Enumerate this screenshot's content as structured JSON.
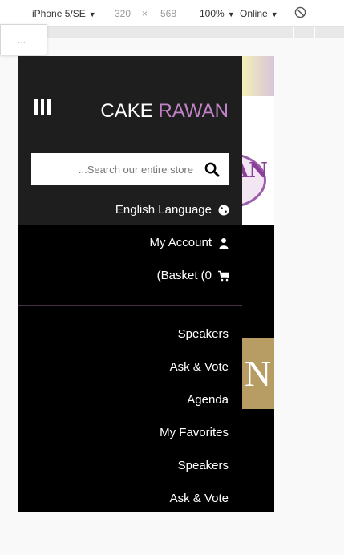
{
  "devtools": {
    "device": "iPhone 5/SE",
    "width": "320",
    "times": "×",
    "height": "568",
    "zoom": "100%",
    "throttle": "Online",
    "more_menu": "..."
  },
  "background": {
    "logo_text": "AN",
    "sign_text": "OPEN"
  },
  "drawer": {
    "brand_part1": "CAKE",
    "brand_part2": "RAWAN",
    "search_placeholder": "...Search our entire store",
    "language": "English Language",
    "account": "My Account",
    "basket": "(Basket (0",
    "menu": [
      "Speakers",
      "Ask & Vote",
      "Agenda",
      "My Favorites",
      "Speakers",
      "Ask & Vote"
    ]
  },
  "colors": {
    "drawer_bg": "#000000",
    "drawer_head_bg": "#1e1e1e",
    "brand_accent": "#c083c6",
    "divider": "#4a2f4c"
  }
}
